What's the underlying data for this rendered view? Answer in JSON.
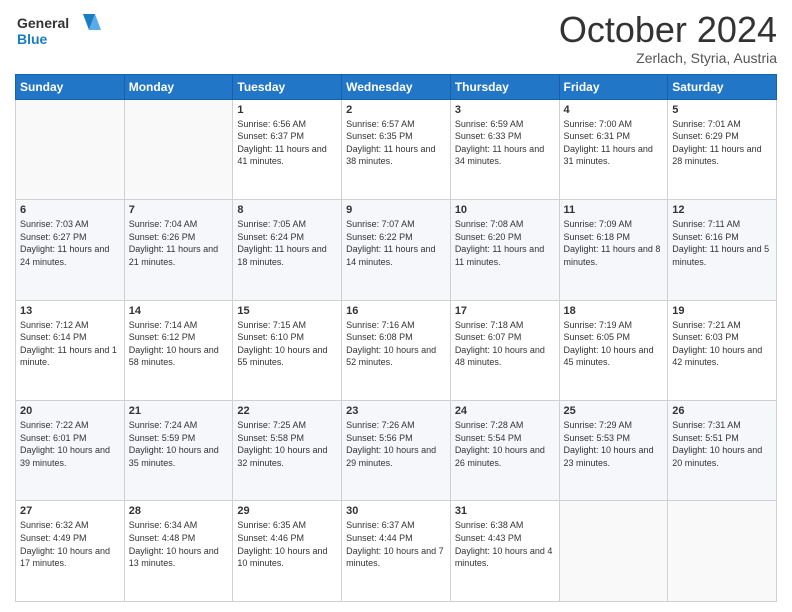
{
  "logo": {
    "line1": "General",
    "line2": "Blue"
  },
  "title": "October 2024",
  "subtitle": "Zerlach, Styria, Austria",
  "weekdays": [
    "Sunday",
    "Monday",
    "Tuesday",
    "Wednesday",
    "Thursday",
    "Friday",
    "Saturday"
  ],
  "weeks": [
    [
      {
        "day": "",
        "sunrise": "",
        "sunset": "",
        "daylight": ""
      },
      {
        "day": "",
        "sunrise": "",
        "sunset": "",
        "daylight": ""
      },
      {
        "day": "1",
        "sunrise": "Sunrise: 6:56 AM",
        "sunset": "Sunset: 6:37 PM",
        "daylight": "Daylight: 11 hours and 41 minutes."
      },
      {
        "day": "2",
        "sunrise": "Sunrise: 6:57 AM",
        "sunset": "Sunset: 6:35 PM",
        "daylight": "Daylight: 11 hours and 38 minutes."
      },
      {
        "day": "3",
        "sunrise": "Sunrise: 6:59 AM",
        "sunset": "Sunset: 6:33 PM",
        "daylight": "Daylight: 11 hours and 34 minutes."
      },
      {
        "day": "4",
        "sunrise": "Sunrise: 7:00 AM",
        "sunset": "Sunset: 6:31 PM",
        "daylight": "Daylight: 11 hours and 31 minutes."
      },
      {
        "day": "5",
        "sunrise": "Sunrise: 7:01 AM",
        "sunset": "Sunset: 6:29 PM",
        "daylight": "Daylight: 11 hours and 28 minutes."
      }
    ],
    [
      {
        "day": "6",
        "sunrise": "Sunrise: 7:03 AM",
        "sunset": "Sunset: 6:27 PM",
        "daylight": "Daylight: 11 hours and 24 minutes."
      },
      {
        "day": "7",
        "sunrise": "Sunrise: 7:04 AM",
        "sunset": "Sunset: 6:26 PM",
        "daylight": "Daylight: 11 hours and 21 minutes."
      },
      {
        "day": "8",
        "sunrise": "Sunrise: 7:05 AM",
        "sunset": "Sunset: 6:24 PM",
        "daylight": "Daylight: 11 hours and 18 minutes."
      },
      {
        "day": "9",
        "sunrise": "Sunrise: 7:07 AM",
        "sunset": "Sunset: 6:22 PM",
        "daylight": "Daylight: 11 hours and 14 minutes."
      },
      {
        "day": "10",
        "sunrise": "Sunrise: 7:08 AM",
        "sunset": "Sunset: 6:20 PM",
        "daylight": "Daylight: 11 hours and 11 minutes."
      },
      {
        "day": "11",
        "sunrise": "Sunrise: 7:09 AM",
        "sunset": "Sunset: 6:18 PM",
        "daylight": "Daylight: 11 hours and 8 minutes."
      },
      {
        "day": "12",
        "sunrise": "Sunrise: 7:11 AM",
        "sunset": "Sunset: 6:16 PM",
        "daylight": "Daylight: 11 hours and 5 minutes."
      }
    ],
    [
      {
        "day": "13",
        "sunrise": "Sunrise: 7:12 AM",
        "sunset": "Sunset: 6:14 PM",
        "daylight": "Daylight: 11 hours and 1 minute."
      },
      {
        "day": "14",
        "sunrise": "Sunrise: 7:14 AM",
        "sunset": "Sunset: 6:12 PM",
        "daylight": "Daylight: 10 hours and 58 minutes."
      },
      {
        "day": "15",
        "sunrise": "Sunrise: 7:15 AM",
        "sunset": "Sunset: 6:10 PM",
        "daylight": "Daylight: 10 hours and 55 minutes."
      },
      {
        "day": "16",
        "sunrise": "Sunrise: 7:16 AM",
        "sunset": "Sunset: 6:08 PM",
        "daylight": "Daylight: 10 hours and 52 minutes."
      },
      {
        "day": "17",
        "sunrise": "Sunrise: 7:18 AM",
        "sunset": "Sunset: 6:07 PM",
        "daylight": "Daylight: 10 hours and 48 minutes."
      },
      {
        "day": "18",
        "sunrise": "Sunrise: 7:19 AM",
        "sunset": "Sunset: 6:05 PM",
        "daylight": "Daylight: 10 hours and 45 minutes."
      },
      {
        "day": "19",
        "sunrise": "Sunrise: 7:21 AM",
        "sunset": "Sunset: 6:03 PM",
        "daylight": "Daylight: 10 hours and 42 minutes."
      }
    ],
    [
      {
        "day": "20",
        "sunrise": "Sunrise: 7:22 AM",
        "sunset": "Sunset: 6:01 PM",
        "daylight": "Daylight: 10 hours and 39 minutes."
      },
      {
        "day": "21",
        "sunrise": "Sunrise: 7:24 AM",
        "sunset": "Sunset: 5:59 PM",
        "daylight": "Daylight: 10 hours and 35 minutes."
      },
      {
        "day": "22",
        "sunrise": "Sunrise: 7:25 AM",
        "sunset": "Sunset: 5:58 PM",
        "daylight": "Daylight: 10 hours and 32 minutes."
      },
      {
        "day": "23",
        "sunrise": "Sunrise: 7:26 AM",
        "sunset": "Sunset: 5:56 PM",
        "daylight": "Daylight: 10 hours and 29 minutes."
      },
      {
        "day": "24",
        "sunrise": "Sunrise: 7:28 AM",
        "sunset": "Sunset: 5:54 PM",
        "daylight": "Daylight: 10 hours and 26 minutes."
      },
      {
        "day": "25",
        "sunrise": "Sunrise: 7:29 AM",
        "sunset": "Sunset: 5:53 PM",
        "daylight": "Daylight: 10 hours and 23 minutes."
      },
      {
        "day": "26",
        "sunrise": "Sunrise: 7:31 AM",
        "sunset": "Sunset: 5:51 PM",
        "daylight": "Daylight: 10 hours and 20 minutes."
      }
    ],
    [
      {
        "day": "27",
        "sunrise": "Sunrise: 6:32 AM",
        "sunset": "Sunset: 4:49 PM",
        "daylight": "Daylight: 10 hours and 17 minutes."
      },
      {
        "day": "28",
        "sunrise": "Sunrise: 6:34 AM",
        "sunset": "Sunset: 4:48 PM",
        "daylight": "Daylight: 10 hours and 13 minutes."
      },
      {
        "day": "29",
        "sunrise": "Sunrise: 6:35 AM",
        "sunset": "Sunset: 4:46 PM",
        "daylight": "Daylight: 10 hours and 10 minutes."
      },
      {
        "day": "30",
        "sunrise": "Sunrise: 6:37 AM",
        "sunset": "Sunset: 4:44 PM",
        "daylight": "Daylight: 10 hours and 7 minutes."
      },
      {
        "day": "31",
        "sunrise": "Sunrise: 6:38 AM",
        "sunset": "Sunset: 4:43 PM",
        "daylight": "Daylight: 10 hours and 4 minutes."
      },
      {
        "day": "",
        "sunrise": "",
        "sunset": "",
        "daylight": ""
      },
      {
        "day": "",
        "sunrise": "",
        "sunset": "",
        "daylight": ""
      }
    ]
  ]
}
